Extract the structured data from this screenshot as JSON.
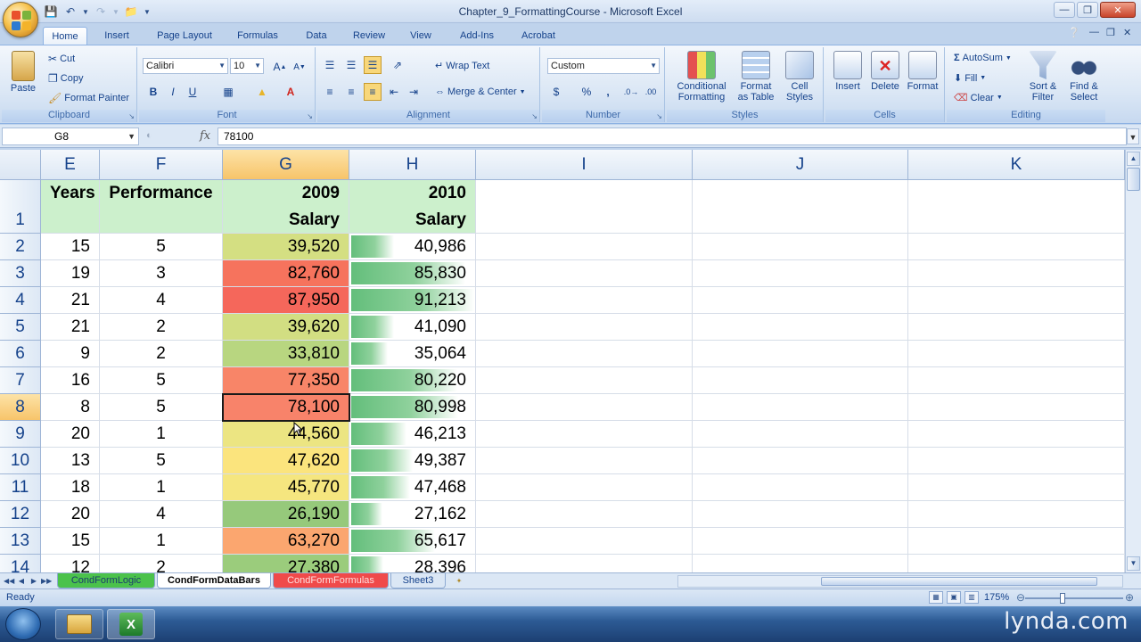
{
  "window": {
    "title": "Chapter_9_FormattingCourse - Microsoft Excel"
  },
  "ribbon_tabs": [
    "Home",
    "Insert",
    "Page Layout",
    "Formulas",
    "Data",
    "Review",
    "View",
    "Add-Ins",
    "Acrobat"
  ],
  "ribbon": {
    "clipboard": {
      "paste": "Paste",
      "cut": "Cut",
      "copy": "Copy",
      "format_painter": "Format Painter",
      "label": "Clipboard"
    },
    "font": {
      "name": "Calibri",
      "size": "10",
      "label": "Font",
      "bold": "B",
      "italic": "I",
      "underline": "U"
    },
    "alignment": {
      "wrap_text": "Wrap Text",
      "merge_center": "Merge & Center",
      "label": "Alignment"
    },
    "number": {
      "format": "Custom",
      "currency": "$",
      "percent": "%",
      "comma": ",",
      "label": "Number"
    },
    "styles": {
      "conditional": [
        "Conditional",
        "Formatting"
      ],
      "format_table": [
        "Format",
        "as Table"
      ],
      "cell_styles": [
        "Cell",
        "Styles"
      ],
      "label": "Styles"
    },
    "cells": {
      "insert": "Insert",
      "delete": "Delete",
      "format": "Format",
      "label": "Cells"
    },
    "editing": {
      "autosum": "AutoSum",
      "fill": "Fill",
      "clear": "Clear",
      "sort_filter": [
        "Sort &",
        "Filter"
      ],
      "find_select": [
        "Find &",
        "Select"
      ],
      "label": "Editing"
    }
  },
  "formula_bar": {
    "name_box": "G8",
    "fx": "fx",
    "value": "78100"
  },
  "columns": [
    "E",
    "F",
    "G",
    "H",
    "I",
    "J",
    "K"
  ],
  "selected_column": "G",
  "selected_row": "8",
  "header_row": {
    "row": "1",
    "E": "Years",
    "F": "Performance",
    "G_line1": "2009",
    "G_line2": "Salary",
    "H_line1": "2010",
    "H_line2": "Salary"
  },
  "rows": [
    {
      "row": "2",
      "E": "15",
      "F": "5",
      "G": "39,520",
      "H": "40,986",
      "g_color": "#d4df82",
      "h_bar": 0.35
    },
    {
      "row": "3",
      "E": "19",
      "F": "3",
      "G": "82,760",
      "H": "85,830",
      "g_color": "#f6735d",
      "h_bar": 0.93
    },
    {
      "row": "4",
      "E": "21",
      "F": "4",
      "G": "87,950",
      "H": "91,213",
      "g_color": "#f5675b",
      "h_bar": 1.0
    },
    {
      "row": "5",
      "E": "21",
      "F": "2",
      "G": "39,620",
      "H": "41,090",
      "g_color": "#d2de82",
      "h_bar": 0.35
    },
    {
      "row": "6",
      "E": "9",
      "F": "2",
      "G": "33,810",
      "H": "35,064",
      "g_color": "#b8d680",
      "h_bar": 0.3
    },
    {
      "row": "7",
      "E": "16",
      "F": "5",
      "G": "77,350",
      "H": "80,220",
      "g_color": "#f88568",
      "h_bar": 0.86
    },
    {
      "row": "8",
      "E": "8",
      "F": "5",
      "G": "78,100",
      "H": "80,998",
      "g_color": "#f8836a",
      "h_bar": 0.87
    },
    {
      "row": "9",
      "E": "20",
      "F": "1",
      "G": "44,560",
      "H": "46,213",
      "g_color": "#ece582",
      "h_bar": 0.45
    },
    {
      "row": "10",
      "E": "13",
      "F": "5",
      "G": "47,620",
      "H": "49,387",
      "g_color": "#fbe47d",
      "h_bar": 0.5
    },
    {
      "row": "11",
      "E": "18",
      "F": "1",
      "G": "45,770",
      "H": "47,468",
      "g_color": "#f5e67f",
      "h_bar": 0.48
    },
    {
      "row": "12",
      "E": "20",
      "F": "4",
      "G": "26,190",
      "H": "27,162",
      "g_color": "#96c97b",
      "h_bar": 0.25
    },
    {
      "row": "13",
      "E": "15",
      "F": "1",
      "G": "63,270",
      "H": "65,617",
      "g_color": "#fba66f",
      "h_bar": 0.68
    },
    {
      "row": "14",
      "E": "12",
      "F": "2",
      "G": "27,380",
      "H": "28,396",
      "g_color": "#9bcc7c",
      "h_bar": 0.26
    }
  ],
  "sheet_tabs": [
    {
      "name": "CondFormLogic",
      "color": "#4bc24b",
      "text_color": "#1b3c6f"
    },
    {
      "name": "CondFormDataBars",
      "color": "#ffffff",
      "text_color": "#000000",
      "active": true
    },
    {
      "name": "CondFormFormulas",
      "color": "#f04a4a",
      "text_color": "#ffdede"
    },
    {
      "name": "Sheet3",
      "color": "#dbe7f5",
      "text_color": "#15428b"
    }
  ],
  "status": {
    "text": "Ready",
    "zoom": "175%"
  },
  "watermark": "lynda.com",
  "icons": {
    "office_button": "office-logo-icon",
    "save": "save-icon",
    "undo": "undo-icon",
    "redo": "redo-icon",
    "open": "folder-icon",
    "help": "help-icon",
    "start": "windows-start-icon",
    "explorer": "folder-icon",
    "excel": "excel-icon"
  }
}
